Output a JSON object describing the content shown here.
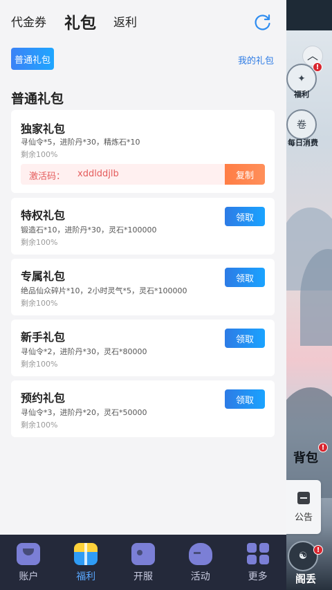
{
  "header": {
    "tabs": [
      {
        "label": "代金券"
      },
      {
        "label": "礼包"
      },
      {
        "label": "返利"
      }
    ]
  },
  "sub_header": {
    "chip_label": "普通礼包",
    "my_gift_link": "我的礼包"
  },
  "section_title": "普通礼包",
  "gifts": [
    {
      "name": "独家礼包",
      "desc": "寻仙令*5，进阶丹*30，精炼石*10",
      "remain": "剩余100%",
      "code_label": "激活码：",
      "code": "xddlddjlb",
      "copy_label": "复制"
    },
    {
      "name": "特权礼包",
      "desc": "锻造石*10，进阶丹*30，灵石*100000",
      "remain": "剩余100%",
      "claim_label": "领取"
    },
    {
      "name": "专属礼包",
      "desc": "绝品仙众碎片*10，2小时灵气*5，灵石*100000",
      "remain": "剩余100%",
      "claim_label": "领取"
    },
    {
      "name": "新手礼包",
      "desc": "寻仙令*2，进阶丹*30，灵石*80000",
      "remain": "剩余100%",
      "claim_label": "领取"
    },
    {
      "name": "预约礼包",
      "desc": "寻仙令*3，进阶丹*20，灵石*50000",
      "remain": "剩余100%",
      "claim_label": "领取"
    }
  ],
  "bottom_nav": [
    {
      "label": "账户",
      "icon": "user-icon"
    },
    {
      "label": "福利",
      "icon": "gift-icon"
    },
    {
      "label": "开服",
      "icon": "gamepad-icon"
    },
    {
      "label": "活动",
      "icon": "controller-icon"
    },
    {
      "label": "更多",
      "icon": "grid-icon"
    }
  ],
  "game_overlay": {
    "welfare": "福利",
    "daily": "每日消费",
    "bag": "背包",
    "notice": "公告",
    "pavilion": "阁丢",
    "badge": "!"
  },
  "colors": {
    "accent_blue": "#2d7be5",
    "copy_orange": "#ff7d45",
    "code_red": "#e45b5b",
    "nav_bg": "#24293a"
  }
}
